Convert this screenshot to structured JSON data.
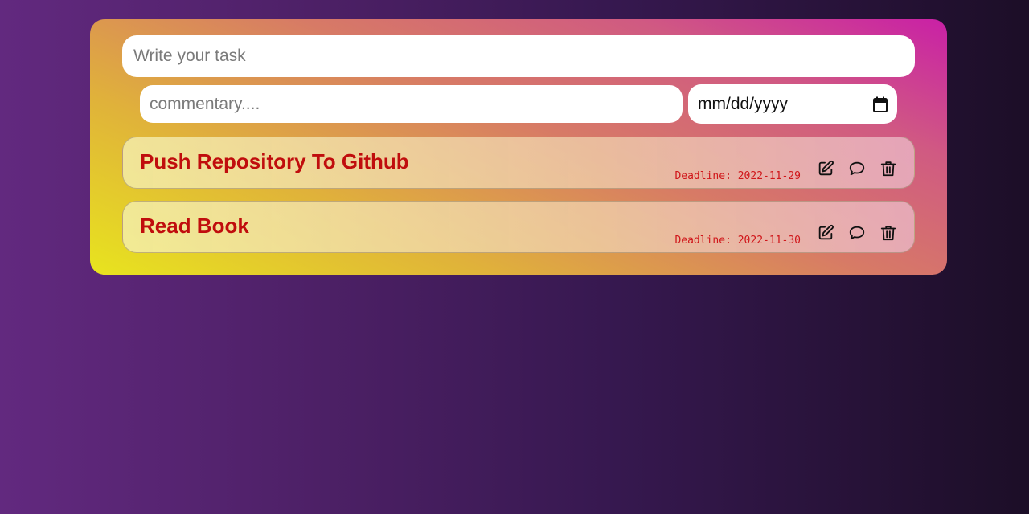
{
  "form": {
    "task_placeholder": "Write your task",
    "task_value": "",
    "comment_placeholder": "commentary....",
    "comment_value": "",
    "date_placeholder": "mm/dd/yyyy",
    "date_icon": "calendar-icon"
  },
  "tasks": [
    {
      "title": "Push Repository To Github",
      "deadline": "Deadline: 2022-11-29",
      "actions": [
        "edit-icon",
        "comment-icon",
        "trash-icon"
      ]
    },
    {
      "title": "Read Book",
      "deadline": "Deadline: 2022-11-30",
      "actions": [
        "edit-icon",
        "comment-icon",
        "trash-icon"
      ]
    }
  ],
  "colors": {
    "task_title": "#c00d0d",
    "deadline": "#d0161a",
    "card_gradient_start": "#e8e41e",
    "card_gradient_end": "#c920a6",
    "background_left": "#62297f",
    "background_right": "#1c0e27"
  }
}
